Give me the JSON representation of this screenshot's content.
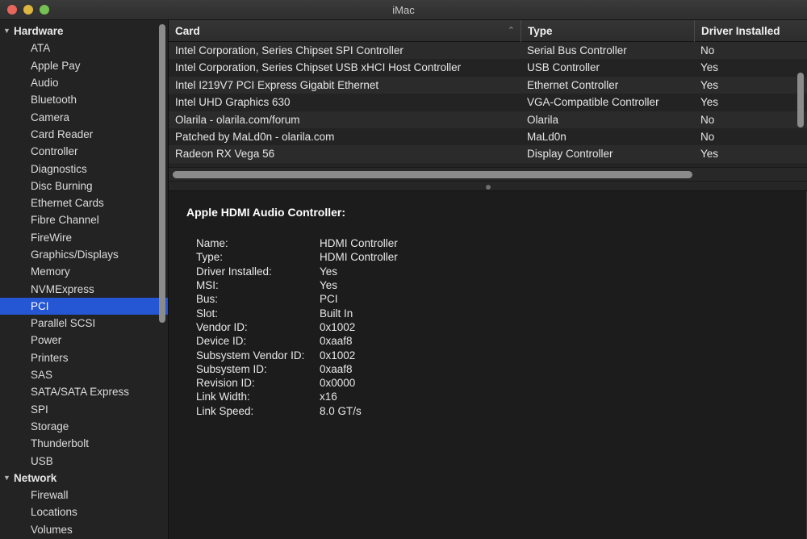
{
  "window": {
    "title": "iMac",
    "traffic_lights": [
      {
        "name": "close",
        "color": "#e8675c"
      },
      {
        "name": "minimize",
        "color": "#ddb63f"
      },
      {
        "name": "maximize",
        "color": "#75c252"
      }
    ]
  },
  "colors": {
    "selection": "#2557d5",
    "titlebar": "#343434",
    "sidebar_bg": "#232323",
    "detail_bg": "#1c1c1c",
    "row_odd": "#2b2b2b",
    "row_even": "#232323",
    "scrollbar": "#8b8b8b"
  },
  "sidebar": {
    "scrollbar": "vertical-scrollbar",
    "items": [
      {
        "label": "Hardware",
        "type": "group",
        "expanded": true,
        "disclosure": "▼"
      },
      {
        "label": "ATA",
        "type": "child"
      },
      {
        "label": "Apple Pay",
        "type": "child"
      },
      {
        "label": "Audio",
        "type": "child"
      },
      {
        "label": "Bluetooth",
        "type": "child"
      },
      {
        "label": "Camera",
        "type": "child"
      },
      {
        "label": "Card Reader",
        "type": "child"
      },
      {
        "label": "Controller",
        "type": "child"
      },
      {
        "label": "Diagnostics",
        "type": "child"
      },
      {
        "label": "Disc Burning",
        "type": "child"
      },
      {
        "label": "Ethernet Cards",
        "type": "child"
      },
      {
        "label": "Fibre Channel",
        "type": "child"
      },
      {
        "label": "FireWire",
        "type": "child"
      },
      {
        "label": "Graphics/Displays",
        "type": "child"
      },
      {
        "label": "Memory",
        "type": "child"
      },
      {
        "label": "NVMExpress",
        "type": "child"
      },
      {
        "label": "PCI",
        "type": "child",
        "selected": true
      },
      {
        "label": "Parallel SCSI",
        "type": "child"
      },
      {
        "label": "Power",
        "type": "child"
      },
      {
        "label": "Printers",
        "type": "child"
      },
      {
        "label": "SAS",
        "type": "child"
      },
      {
        "label": "SATA/SATA Express",
        "type": "child"
      },
      {
        "label": "SPI",
        "type": "child"
      },
      {
        "label": "Storage",
        "type": "child"
      },
      {
        "label": "Thunderbolt",
        "type": "child"
      },
      {
        "label": "USB",
        "type": "child"
      },
      {
        "label": "Network",
        "type": "group",
        "expanded": true,
        "disclosure": "▼"
      },
      {
        "label": "Firewall",
        "type": "child"
      },
      {
        "label": "Locations",
        "type": "child"
      },
      {
        "label": "Volumes",
        "type": "child"
      }
    ]
  },
  "table": {
    "columns": [
      {
        "key": "card",
        "label": "Card",
        "sorted": true,
        "sort_indicator": "⌃"
      },
      {
        "key": "type",
        "label": "Type"
      },
      {
        "key": "driver",
        "label": "Driver Installed"
      }
    ],
    "rows": [
      {
        "card": "Intel Corporation, Series Chipset SPI Controller",
        "type": "Serial Bus Controller",
        "driver": "No"
      },
      {
        "card": "Intel Corporation, Series Chipset USB xHCI Host Controller",
        "type": "USB Controller",
        "driver": "Yes"
      },
      {
        "card": "Intel I219V7 PCI Express Gigabit Ethernet",
        "type": "Ethernet Controller",
        "driver": "Yes"
      },
      {
        "card": "Intel UHD Graphics 630",
        "type": "VGA-Compatible Controller",
        "driver": "Yes"
      },
      {
        "card": "Olarila - olarila.com/forum",
        "type": "Olarila",
        "driver": "No"
      },
      {
        "card": "Patched by MaLd0n - olarila.com",
        "type": "MaLd0n",
        "driver": "No"
      },
      {
        "card": "Radeon RX Vega 56",
        "type": "Display Controller",
        "driver": "Yes"
      }
    ]
  },
  "detail": {
    "title": "Apple HDMI Audio Controller:",
    "fields": [
      {
        "label": "Name:",
        "value": "HDMI Controller"
      },
      {
        "label": "Type:",
        "value": "HDMI Controller"
      },
      {
        "label": "Driver Installed:",
        "value": "Yes"
      },
      {
        "label": "MSI:",
        "value": "Yes"
      },
      {
        "label": "Bus:",
        "value": "PCI"
      },
      {
        "label": "Slot:",
        "value": "Built In"
      },
      {
        "label": "Vendor ID:",
        "value": "0x1002"
      },
      {
        "label": "Device ID:",
        "value": "0xaaf8"
      },
      {
        "label": "Subsystem Vendor ID:",
        "value": "0x1002"
      },
      {
        "label": "Subsystem ID:",
        "value": "0xaaf8"
      },
      {
        "label": "Revision ID:",
        "value": "0x0000"
      },
      {
        "label": "Link Width:",
        "value": "x16"
      },
      {
        "label": "Link Speed:",
        "value": "8.0 GT/s"
      }
    ]
  }
}
